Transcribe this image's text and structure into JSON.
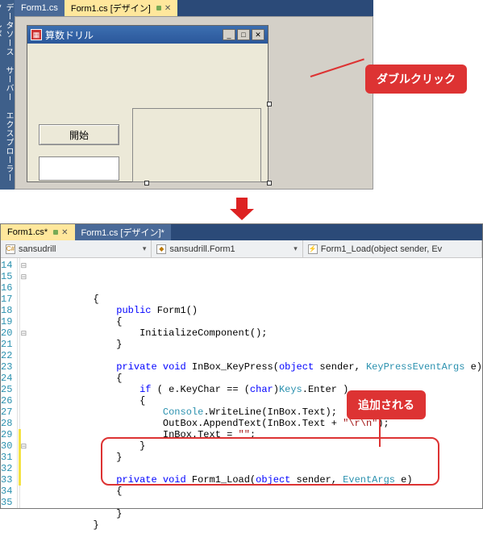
{
  "top": {
    "side_labels": "データソース サーバー エクスプローラー ツールボ",
    "tabs": [
      {
        "label": "Form1.cs",
        "active": false
      },
      {
        "label": "Form1.cs [デザイン]",
        "active": true
      }
    ],
    "form_title": "算数ドリル",
    "start_button": "開始",
    "callout": "ダブルクリック"
  },
  "bottom": {
    "tabs": [
      {
        "label": "Form1.cs*",
        "active": true
      },
      {
        "label": "Form1.cs [デザイン]*",
        "active": false
      }
    ],
    "crumb1": "sansudrill",
    "crumb2": "sansudrill.Form1",
    "crumb3": "Form1_Load(object sender, Ev",
    "callout": "追加される",
    "lines": [
      {
        "n": 14,
        "html": "            {"
      },
      {
        "n": 15,
        "html": "                <span class='kw'>public</span> Form1()"
      },
      {
        "n": 16,
        "html": "                {"
      },
      {
        "n": 17,
        "html": "                    InitializeComponent();"
      },
      {
        "n": 18,
        "html": "                }"
      },
      {
        "n": 19,
        "html": ""
      },
      {
        "n": 20,
        "html": "                <span class='kw'>private</span> <span class='kw'>void</span> InBox_KeyPress(<span class='kw'>object</span> sender, <span class='tp'>KeyPressEventArgs</span> e)"
      },
      {
        "n": 21,
        "html": "                {"
      },
      {
        "n": 22,
        "html": "                    <span class='kw'>if</span> ( e.KeyChar == (<span class='kw'>char</span>)<span class='tp'>Keys</span>.Enter )"
      },
      {
        "n": 23,
        "html": "                    {"
      },
      {
        "n": 24,
        "html": "                        <span class='tp'>Console</span>.WriteLine(InBox.Text);"
      },
      {
        "n": 25,
        "html": "                        OutBox.AppendText(InBox.Text + <span class='st'>\"\\r\\n\"</span>);"
      },
      {
        "n": 26,
        "html": "                        InBox.Text = <span class='st'>\"\"</span>;"
      },
      {
        "n": 27,
        "html": "                    }"
      },
      {
        "n": 28,
        "html": "                }"
      },
      {
        "n": 29,
        "html": ""
      },
      {
        "n": 30,
        "html": "                <span class='kw'>private</span> <span class='kw'>void</span> Form1_Load(<span class='kw'>object</span> sender, <span class='tp'>EventArgs</span> e)"
      },
      {
        "n": 31,
        "html": "                {"
      },
      {
        "n": 32,
        "html": ""
      },
      {
        "n": 33,
        "html": "                }"
      },
      {
        "n": 34,
        "html": "            }"
      },
      {
        "n": 35,
        "html": ""
      }
    ]
  }
}
